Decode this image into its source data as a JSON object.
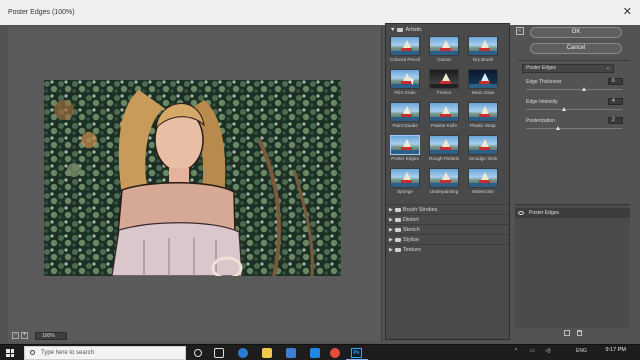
{
  "window": {
    "title": "Poster Edges (100%)"
  },
  "preview": {
    "zoom": "100%",
    "zoom_out": "−",
    "zoom_in": "+"
  },
  "gallery": {
    "open_category": "Artistic",
    "thumbnails": [
      "Colored Pencil",
      "Cutout",
      "Dry Brush",
      "Film Grain",
      "Fresco",
      "Neon Glow",
      "Paint Daubs",
      "Palette Knife",
      "Plastic Wrap",
      "Poster Edges",
      "Rough Pastels",
      "Smudge Stick",
      "Sponge",
      "Underpainting",
      "Watercolor"
    ],
    "selected": "Poster Edges",
    "categories": [
      "Brush Strokes",
      "Distort",
      "Sketch",
      "Stylize",
      "Texture"
    ]
  },
  "buttons": {
    "ok": "OK",
    "cancel": "Cancel"
  },
  "settings": {
    "filter": "Poster Edges",
    "params": [
      {
        "name": "Edge Thickness",
        "value": "6",
        "level": 0.6
      },
      {
        "name": "Edge Intensity",
        "value": "4",
        "level": 0.4
      },
      {
        "name": "Posterization",
        "value": "2",
        "level": 0.33
      }
    ]
  },
  "layers": {
    "items": [
      "Poster Edges"
    ]
  },
  "taskbar": {
    "search_placeholder": "Type here to search",
    "lang": "ENG",
    "time": "9:17 PM"
  },
  "colors": {
    "ps_blue": "#31a8ff",
    "selection": "#9ec7ff"
  }
}
